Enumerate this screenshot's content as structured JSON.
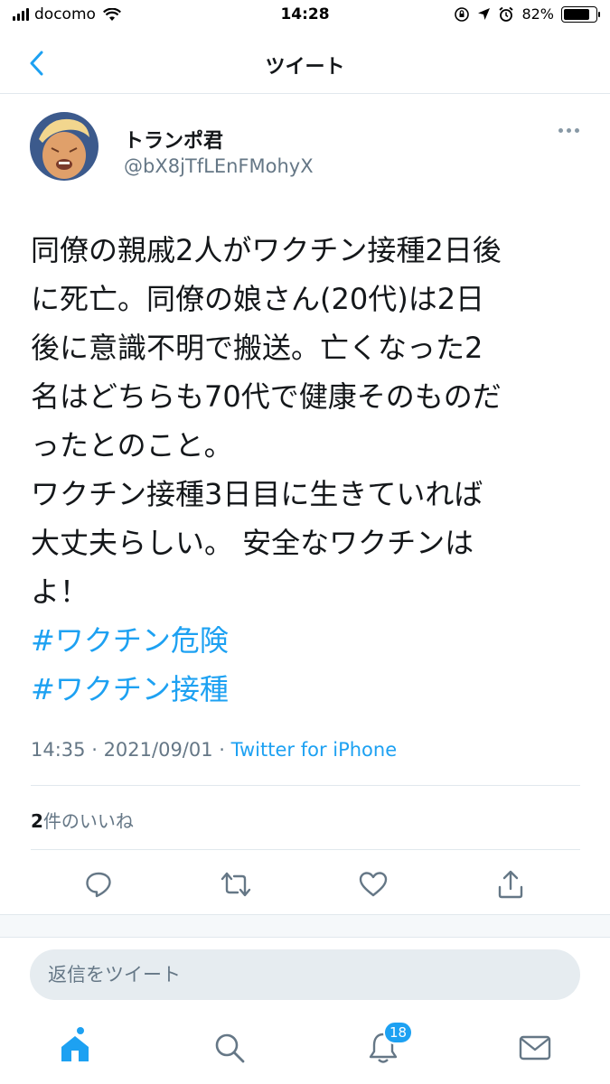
{
  "status_bar": {
    "carrier": "docomo",
    "time": "14:28",
    "battery": "82%",
    "battery_level": 0.82
  },
  "nav": {
    "title": "ツイート",
    "back_icon": "chevron-left-icon"
  },
  "tweet": {
    "display_name": "トランポ君",
    "handle": "@bX8jTfLEnFMohyX",
    "body_lines": [
      "同僚の親戚2人がワクチン接種2日後",
      "に死亡。同僚の娘さん(20代)は2日",
      "後に意識不明で搬送。亡くなった2",
      "名はどちらも70代で健康そのものだ",
      "ったとのこと。",
      "ワクチン接種3日目に生きていれば",
      "大丈夫らしい。 安全なワクチンは",
      "よ！"
    ],
    "hashtags": [
      "#ワクチン危険",
      "#ワクチン接種"
    ],
    "time": "14:35",
    "date": "2021/09/01",
    "separator": " · ",
    "source": "Twitter for iPhone",
    "likes_count": "2",
    "likes_label": "件のいいね"
  },
  "actions": {
    "reply_icon": "reply-icon",
    "retweet_icon": "retweet-icon",
    "like_icon": "heart-icon",
    "share_icon": "share-icon"
  },
  "reply": {
    "placeholder": "返信をツイート"
  },
  "tab_bar": {
    "notification_badge": "18"
  },
  "colors": {
    "accent": "#1da1f2",
    "secondary_text": "#657786",
    "divider": "#e1e8ed"
  }
}
